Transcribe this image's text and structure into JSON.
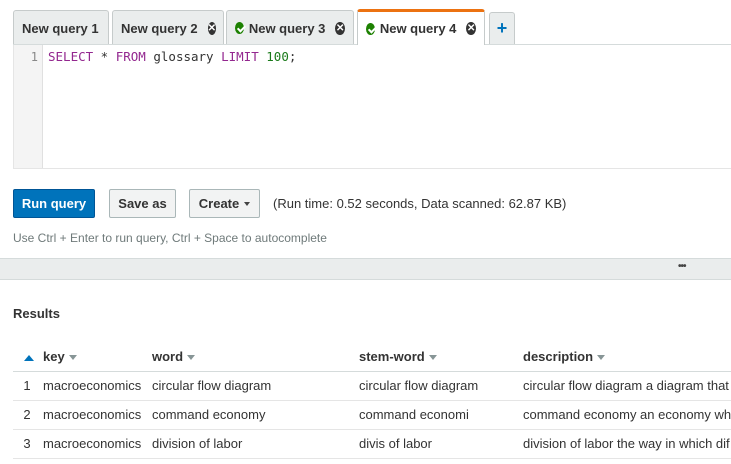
{
  "tabs": [
    {
      "label": "New query 1",
      "closable": false,
      "status": "none"
    },
    {
      "label": "New query 2",
      "closable": true,
      "status": "none"
    },
    {
      "label": "New query 3",
      "closable": true,
      "status": "succeeded"
    },
    {
      "label": "New query 4",
      "closable": true,
      "status": "succeeded",
      "active": true
    }
  ],
  "add_tab_label": "+",
  "editor": {
    "line_number": "1",
    "tokens": [
      {
        "text": "SELECT",
        "class": "kw"
      },
      {
        "text": " * ",
        "class": ""
      },
      {
        "text": "FROM",
        "class": "kw"
      },
      {
        "text": " glossary ",
        "class": ""
      },
      {
        "text": "LIMIT",
        "class": "kw"
      },
      {
        "text": " ",
        "class": ""
      },
      {
        "text": "100",
        "class": "num"
      },
      {
        "text": ";",
        "class": ""
      }
    ]
  },
  "buttons": {
    "run": "Run query",
    "save_as": "Save as",
    "create": "Create"
  },
  "run_stats": "(Run time: 0.52 seconds, Data scanned: 62.87 KB)",
  "hint": "Use Ctrl + Enter to run query, Ctrl + Space to autocomplete",
  "divider_grip": "•••",
  "results": {
    "title": "Results",
    "columns": [
      "key",
      "word",
      "stem-word",
      "description"
    ],
    "rows": [
      {
        "n": "1",
        "key": "macroeconomics",
        "word": "circular flow diagram",
        "stem": "circular flow diagram",
        "description": "circular flow diagram a diagram that"
      },
      {
        "n": "2",
        "key": "macroeconomics",
        "word": "command economy",
        "stem": "command economi",
        "description": "command economy an economy wh"
      },
      {
        "n": "3",
        "key": "macroeconomics",
        "word": "division of labor",
        "stem": "divis of labor",
        "description": "division of labor the way in which dif"
      }
    ]
  },
  "colors": {
    "primary": "#0073bb",
    "active_tab_accent": "#ec7211",
    "success": "#1d8102"
  }
}
